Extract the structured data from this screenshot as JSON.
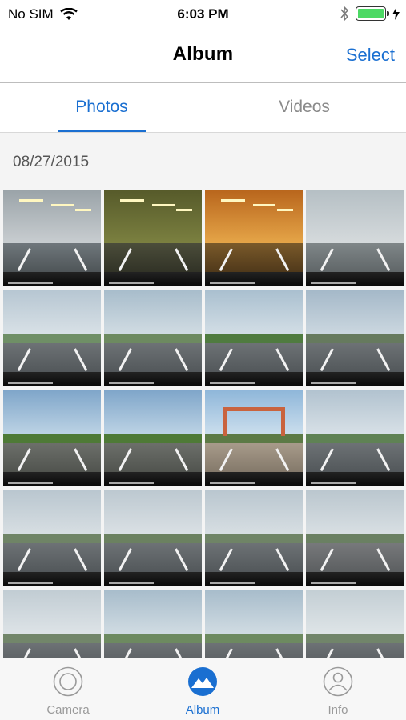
{
  "status_bar": {
    "carrier": "No SIM",
    "time": "6:03 PM",
    "battery_level": 1.0
  },
  "nav": {
    "title": "Album",
    "select_label": "Select"
  },
  "segments": {
    "photos": "Photos",
    "videos": "Videos",
    "active": "photos"
  },
  "section": {
    "date": "08/27/2015"
  },
  "colors": {
    "accent": "#1a6fd1",
    "battery": "#4cd964",
    "inactive": "#9a9a9a"
  },
  "thumbnails": [
    {
      "scene": "garage"
    },
    {
      "scene": "tunnel"
    },
    {
      "scene": "tunnel-orange"
    },
    {
      "scene": "bridge"
    },
    {
      "scene": "highway-truck"
    },
    {
      "scene": "highway"
    },
    {
      "scene": "highway-trees"
    },
    {
      "scene": "highway-tower"
    },
    {
      "scene": "rural-road"
    },
    {
      "scene": "rural-road"
    },
    {
      "scene": "gate"
    },
    {
      "scene": "highway-car"
    },
    {
      "scene": "highway-overpass"
    },
    {
      "scene": "highway-sign"
    },
    {
      "scene": "highway-overpass"
    },
    {
      "scene": "highway-markings"
    },
    {
      "scene": "highway-greensign"
    },
    {
      "scene": "highway"
    },
    {
      "scene": "highway"
    },
    {
      "scene": "highway-redsign"
    }
  ],
  "tab_bar": {
    "items": [
      {
        "label": "Camera",
        "icon": "camera-icon"
      },
      {
        "label": "Album",
        "icon": "album-icon"
      },
      {
        "label": "Info",
        "icon": "info-icon"
      }
    ],
    "active_index": 1
  }
}
